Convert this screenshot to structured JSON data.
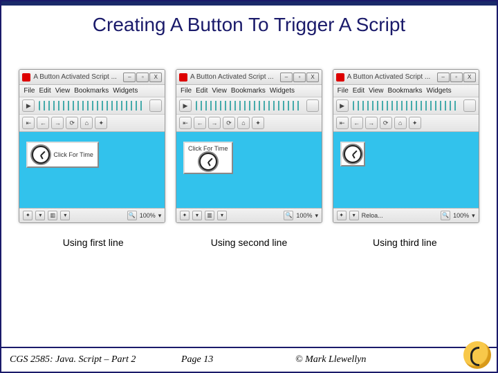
{
  "title": "Creating A Button To Trigger A Script",
  "window": {
    "title": "A Button Activated Script ...",
    "min": "–",
    "max": "▫",
    "close": "X"
  },
  "menus": [
    "File",
    "Edit",
    "View",
    "Bookmarks",
    "Widgets"
  ],
  "toolbar": {
    "play": "▶"
  },
  "nav": {
    "rewind": "⇤",
    "back": "←",
    "forward": "→",
    "reload": "⟳",
    "home": "⌂",
    "wand": "✦"
  },
  "status": {
    "zoom": "100%",
    "magnify": "🔍",
    "dropdown": "▾",
    "reload_text": "Reloa..."
  },
  "buttons": {
    "click_for_time": "Click For Time"
  },
  "captions": [
    "Using first line",
    "Using second line",
    "Using third line"
  ],
  "footer": {
    "course": "CGS 2585: Java. Script – Part 2",
    "page": "Page 13",
    "copyright": "© Mark Llewellyn"
  }
}
